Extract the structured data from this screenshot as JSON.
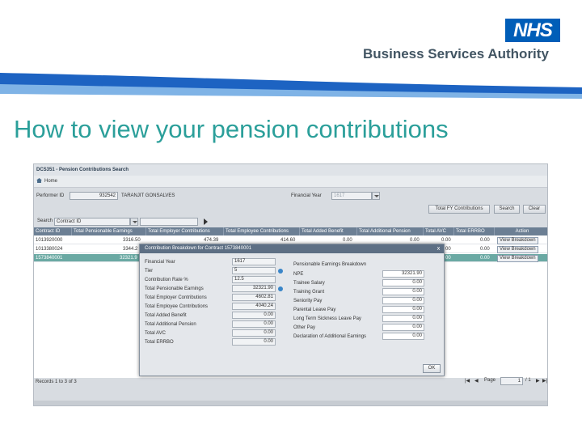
{
  "slide": {
    "logo": "NHS",
    "org_name": "Business Services Authority",
    "title": "How to view your pension contributions"
  },
  "app": {
    "window_title": "DCS351 - Pension Contributions Search",
    "home_label": "Home",
    "performer_id_label": "Performer ID",
    "performer_id_value": "932542",
    "performer_name": "TARANJIT GONSALVES",
    "financial_year_label": "Financial Year",
    "financial_year_value": "1617",
    "buttons": {
      "total_fy": "Total FY Contributions",
      "search": "Search",
      "clear": "Clear"
    },
    "search_label": "Search",
    "search_by": "Contract ID",
    "grid": {
      "headers": [
        "Contract ID",
        "Total Pensionable Earnings",
        "Total Employer Contributions",
        "Total Employee Contributions",
        "Total Added Benefit",
        "Total Additional Pension",
        "Total AVC",
        "Total ERRBO",
        "Action"
      ],
      "rows": [
        {
          "contract_id": "1013920000",
          "earnings": "3316.50",
          "employer": "474.39",
          "employee": "414.60",
          "added_benefit": "0.00",
          "additional_pension": "0.00",
          "avc": "0.00",
          "errbo": "0.00",
          "action": "View Breakdown",
          "selected": false
        },
        {
          "contract_id": "1013380024",
          "earnings": "3344.2",
          "employer": "",
          "employee": "",
          "added_benefit": "",
          "additional_pension": "",
          "avc": "00",
          "errbo": "0.00",
          "action": "View Breakdown",
          "selected": false
        },
        {
          "contract_id": "1573840001",
          "earnings": "32321.9",
          "employer": "",
          "employee": "",
          "added_benefit": "",
          "additional_pension": "",
          "avc": "00",
          "errbo": "0.00",
          "action": "View Breakdown",
          "selected": true
        }
      ]
    },
    "records_text": "Records 1 to 3 of 3",
    "pager": {
      "page_label": "Page",
      "page_value": "1",
      "page_of": "/ 1"
    }
  },
  "dialog": {
    "title": "Contribution Breakdown for Contract 1573840001",
    "close_label": "x",
    "left": [
      {
        "label": "Financial Year",
        "value": "1617",
        "info": false
      },
      {
        "label": "Tier",
        "value": "5",
        "info": true
      },
      {
        "label": "Contribution Rate %",
        "value": "12.5",
        "info": false
      },
      {
        "label": "Total Pensionable Earnings",
        "value": "32321.90",
        "info": true
      },
      {
        "label": "Total Employer Contributions",
        "value": "4602.81",
        "info": false
      },
      {
        "label": "Total Employee Contributions",
        "value": "4040.24",
        "info": false
      },
      {
        "label": "Total Added Benefit",
        "value": "0.00",
        "info": false
      },
      {
        "label": "Total Additional Pension",
        "value": "0.00",
        "info": false
      },
      {
        "label": "Total AVC",
        "value": "0.00",
        "info": false
      },
      {
        "label": "Total ERRBO",
        "value": "0.00",
        "info": false
      }
    ],
    "right_heading": "Pensionable Earnings Breakdown",
    "right": [
      {
        "label": "NPE",
        "value": "32321.90"
      },
      {
        "label": "Trainee Salary",
        "value": "0.00"
      },
      {
        "label": "Training Grant",
        "value": "0.00"
      },
      {
        "label": "Seniority Pay",
        "value": "0.00"
      },
      {
        "label": "Parental Leave Pay",
        "value": "0.00"
      },
      {
        "label": "Long Term Sickness Leave Pay",
        "value": "0.00"
      },
      {
        "label": "Other Pay",
        "value": "0.00"
      },
      {
        "label": "Declaration of Additional Earnings",
        "value": "0.00"
      }
    ],
    "ok_label": "OK"
  },
  "colors": {
    "nhs_blue": "#005eb8",
    "title_teal": "#2b9f9a",
    "selected_row": "#6aa9a3",
    "grid_header": "#6c7f94"
  }
}
